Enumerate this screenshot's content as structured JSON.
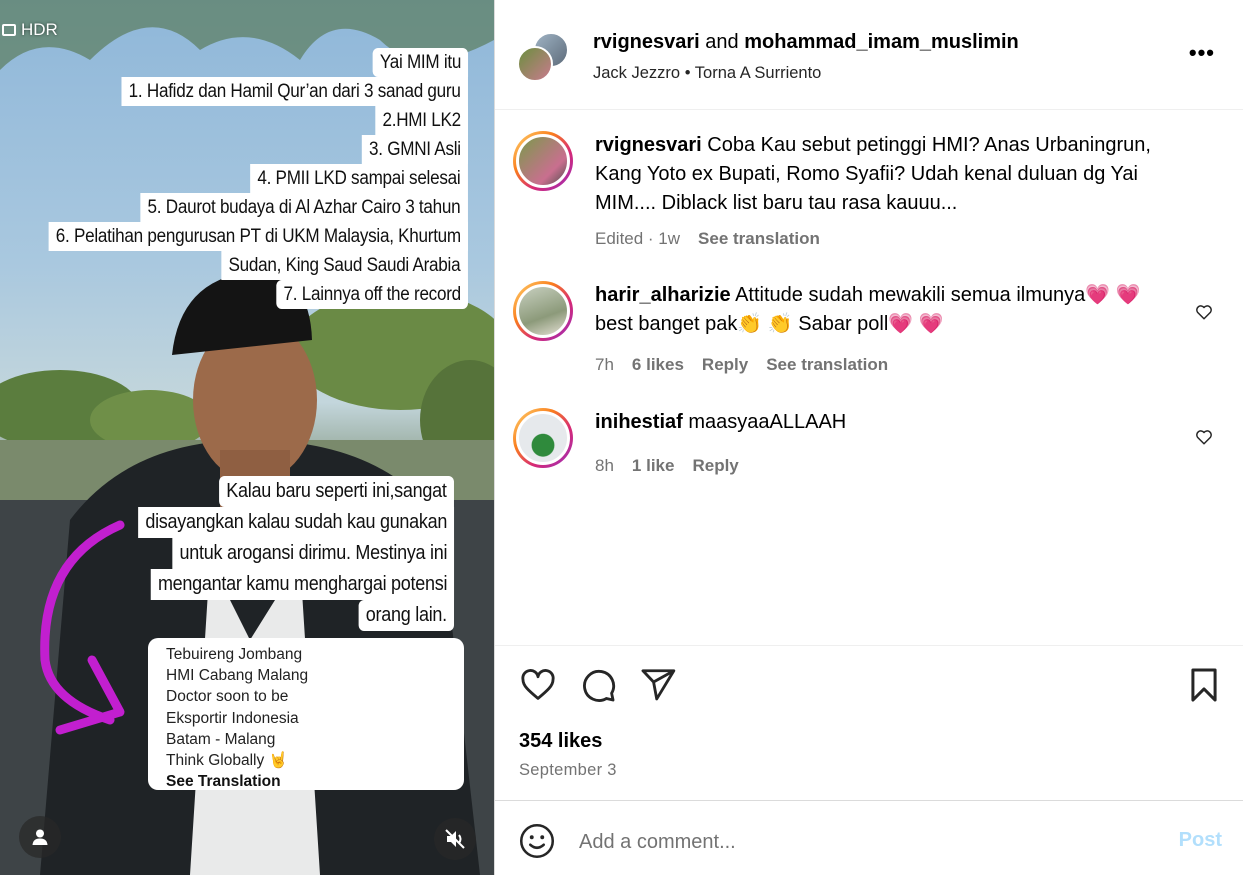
{
  "media": {
    "hdr_label": "HDR",
    "caption_top": [
      "Yai MIM itu",
      "1. Hafidz dan Hamil Qur’an dari 3 sanad guru",
      "2.HMI LK2",
      "3. GMNI Asli",
      "4. PMII LKD sampai selesai",
      "5. Daurot budaya di Al Azhar Cairo 3 tahun",
      "6. Pelatihan pengurusan PT di UKM Malaysia, Khurtum",
      "Sudan, King Saud Saudi Arabia",
      "7. Lainnya off the record"
    ],
    "caption_bottom": [
      "Kalau baru seperti ini,sangat",
      "disayangkan kalau sudah kau gunakan",
      "untuk arogansi dirimu. Mestinya ini",
      "mengantar kamu menghargai potensi",
      "orang lain."
    ],
    "bio_lines": [
      "Tebuireng Jombang",
      "HMI Cabang Malang",
      "Doctor soon to be",
      "Eksportir Indonesia",
      "Batam - Malang",
      "Think Globally 🤘"
    ],
    "bio_see_translation": "See Translation",
    "profile_icon": "user-icon",
    "mute_icon": "muted-speaker-icon"
  },
  "header": {
    "user1": "rvignesvari",
    "joiner": "and",
    "user2": "mohammad_imam_muslimin",
    "audio_artist": "Jack Jezzro",
    "audio_separator": "•",
    "audio_track": "Torna A Surriento",
    "more_icon": "more-horizontal-icon",
    "more_label": "•••"
  },
  "comments": [
    {
      "user": "rvignesvari",
      "text": "Coba Kau sebut petinggi HMI? Anas Urbaningrun, Kang Yoto ex Bupati, Romo Syafii? Udah kenal duluan dg Yai MIM.... Diblack list baru tau rasa kauuu...",
      "time": "Edited · 1w",
      "likes": "",
      "reply": "",
      "translate": "See translation"
    },
    {
      "user": "harir_alharizie",
      "text": "Attitude sudah mewakili semua ilmunya💗 💗 best banget pak👏 👏 Sabar poll💗 💗",
      "time": "7h",
      "likes": "6 likes",
      "reply": "Reply",
      "translate": "See translation"
    },
    {
      "user": "inihestiaf",
      "text": "maasyaaALLAAH",
      "time": "8h",
      "likes": "1 like",
      "reply": "Reply",
      "translate": ""
    }
  ],
  "actions": {
    "like_icon": "heart-icon",
    "comment_icon": "comment-bubble-icon",
    "share_icon": "paper-plane-icon",
    "save_icon": "bookmark-icon",
    "likes_count": "354 likes",
    "date": "September 3"
  },
  "add_comment": {
    "emoji_icon": "smiley-icon",
    "placeholder": "Add a comment...",
    "post_label": "Post",
    "post_color": "#b2dffc"
  }
}
